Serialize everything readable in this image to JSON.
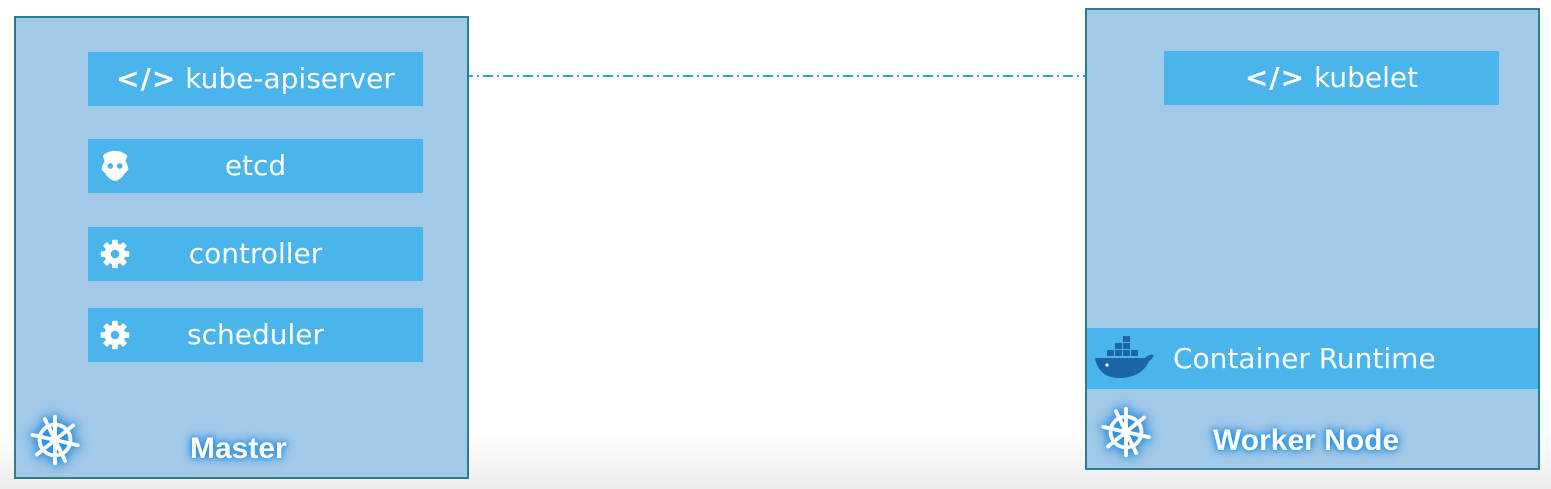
{
  "master": {
    "title": "Master",
    "components": {
      "apiserver": "kube-apiserver",
      "etcd": "etcd",
      "controller": "controller",
      "scheduler": "scheduler"
    }
  },
  "worker": {
    "title": "Worker Node",
    "components": {
      "kubelet": "kubelet",
      "runtime": "Container Runtime"
    }
  },
  "glyphs": {
    "code": "</>"
  },
  "icons": {
    "apiserver": "code-brackets-icon",
    "etcd": "etcd-icon",
    "controller": "gear-icon",
    "scheduler": "gear-icon",
    "kubelet": "code-brackets-icon",
    "runtime": "docker-whale-icon",
    "node": "kubernetes-helm-icon"
  },
  "colors": {
    "node_fill": "#a3c9e8",
    "node_border": "#2b7f8c",
    "component_fill": "#4ab4ec",
    "link": "#2aa0dc"
  }
}
